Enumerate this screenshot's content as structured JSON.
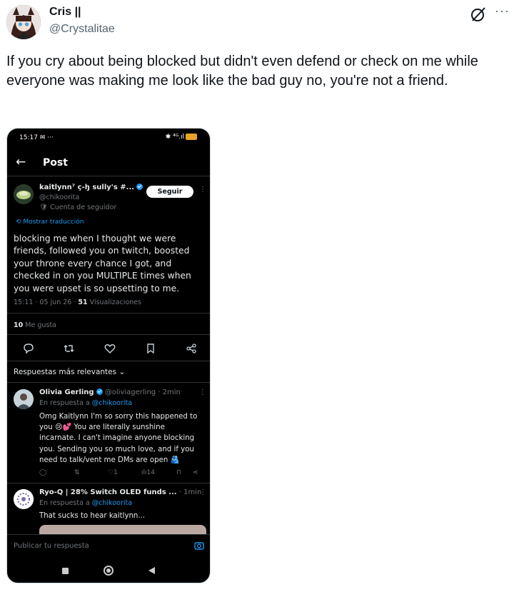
{
  "tweet": {
    "display_name": "Cris ||",
    "handle": "@Crystalitae",
    "text": "If you cry about being blocked but didn't even defend or check on me while everyone was making me look like the bad guy no, you're not a friend.",
    "more_label": "···"
  },
  "phone": {
    "status_time": "15:17",
    "status_icons": "✉ ···",
    "status_right": "✱ ⁴ᴳ.ıl",
    "battery_label": "56",
    "header_title": "Post",
    "post": {
      "author": "kaitlynn⁷ ç-ꜧ sully's #...",
      "handle": "@chikoorita",
      "badge": "Cuenta de seguidor",
      "follow_label": "Seguir",
      "translate_label": "Mostrar traducción",
      "text": "blocking me when I thought we were friends, followed you on twitch, boosted your throne every chance I got, and checked in on you MULTIPLE times when you were upset is so upsetting to me.",
      "time": "15:11 · 05 jun 26 · ",
      "views_count": "51",
      "views_label": " Visualizaciones",
      "likes_count": "10",
      "likes_label": " Me gusta"
    },
    "replies_filter": "Respuestas más relevantes ⌄",
    "replies": [
      {
        "name": "Olivia Gerling",
        "meta": "@oliviagerling · 2min",
        "reply_to_prefix": "En respuesta a ",
        "reply_to": "@chikoorita",
        "text": "Omg Kaitlynn I'm so sorry this happened to you 😢💕 You are literally sunshine incarnate. I can't imagine anyone blocking you. Sending you so much love, and if you need to talk/vent me DMs are open 🫂",
        "like_count": "1",
        "view_count": "14"
      },
      {
        "name": "Ryo-Q | 28% Switch OLED funds ...",
        "meta": "· 1min",
        "reply_to_prefix": "En respuesta a ",
        "reply_to": "@chikoorita",
        "text": "That sucks to hear kaitlynn..."
      }
    ],
    "compose_placeholder": "Publicar tu respuesta"
  },
  "colors": {
    "link_blue": "#1d9bf0",
    "phone_bg": "#000000",
    "muted_gray": "#71767b"
  }
}
